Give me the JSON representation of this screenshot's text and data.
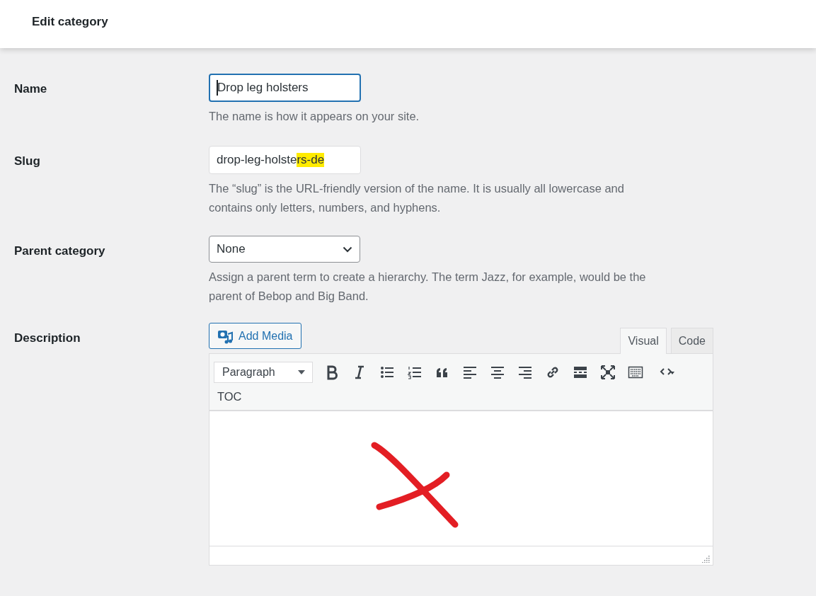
{
  "header": {
    "title": "Edit category"
  },
  "name_field": {
    "label": "Name",
    "value": "Drop leg holsters",
    "focused": true,
    "help": "The name is how it appears on your site."
  },
  "slug_field": {
    "label": "Slug",
    "value_plain": "drop-leg-holste",
    "value_highlighted": "rs-de",
    "help": "The “slug” is the URL-friendly version of the name. It is usually all lowercase and contains only letters, numbers, and hyphens."
  },
  "parent_field": {
    "label": "Parent category",
    "value": "None",
    "help": "Assign a parent term to create a hierarchy. The term Jazz, for example, would be the parent of Bebop and Big Band."
  },
  "description": {
    "label": "Description",
    "add_media": "Add Media",
    "tabs": [
      {
        "label": "Visual",
        "selected": true
      },
      {
        "label": "Code",
        "selected": false
      }
    ],
    "format_select": "Paragraph",
    "toc_button": "TOC"
  }
}
